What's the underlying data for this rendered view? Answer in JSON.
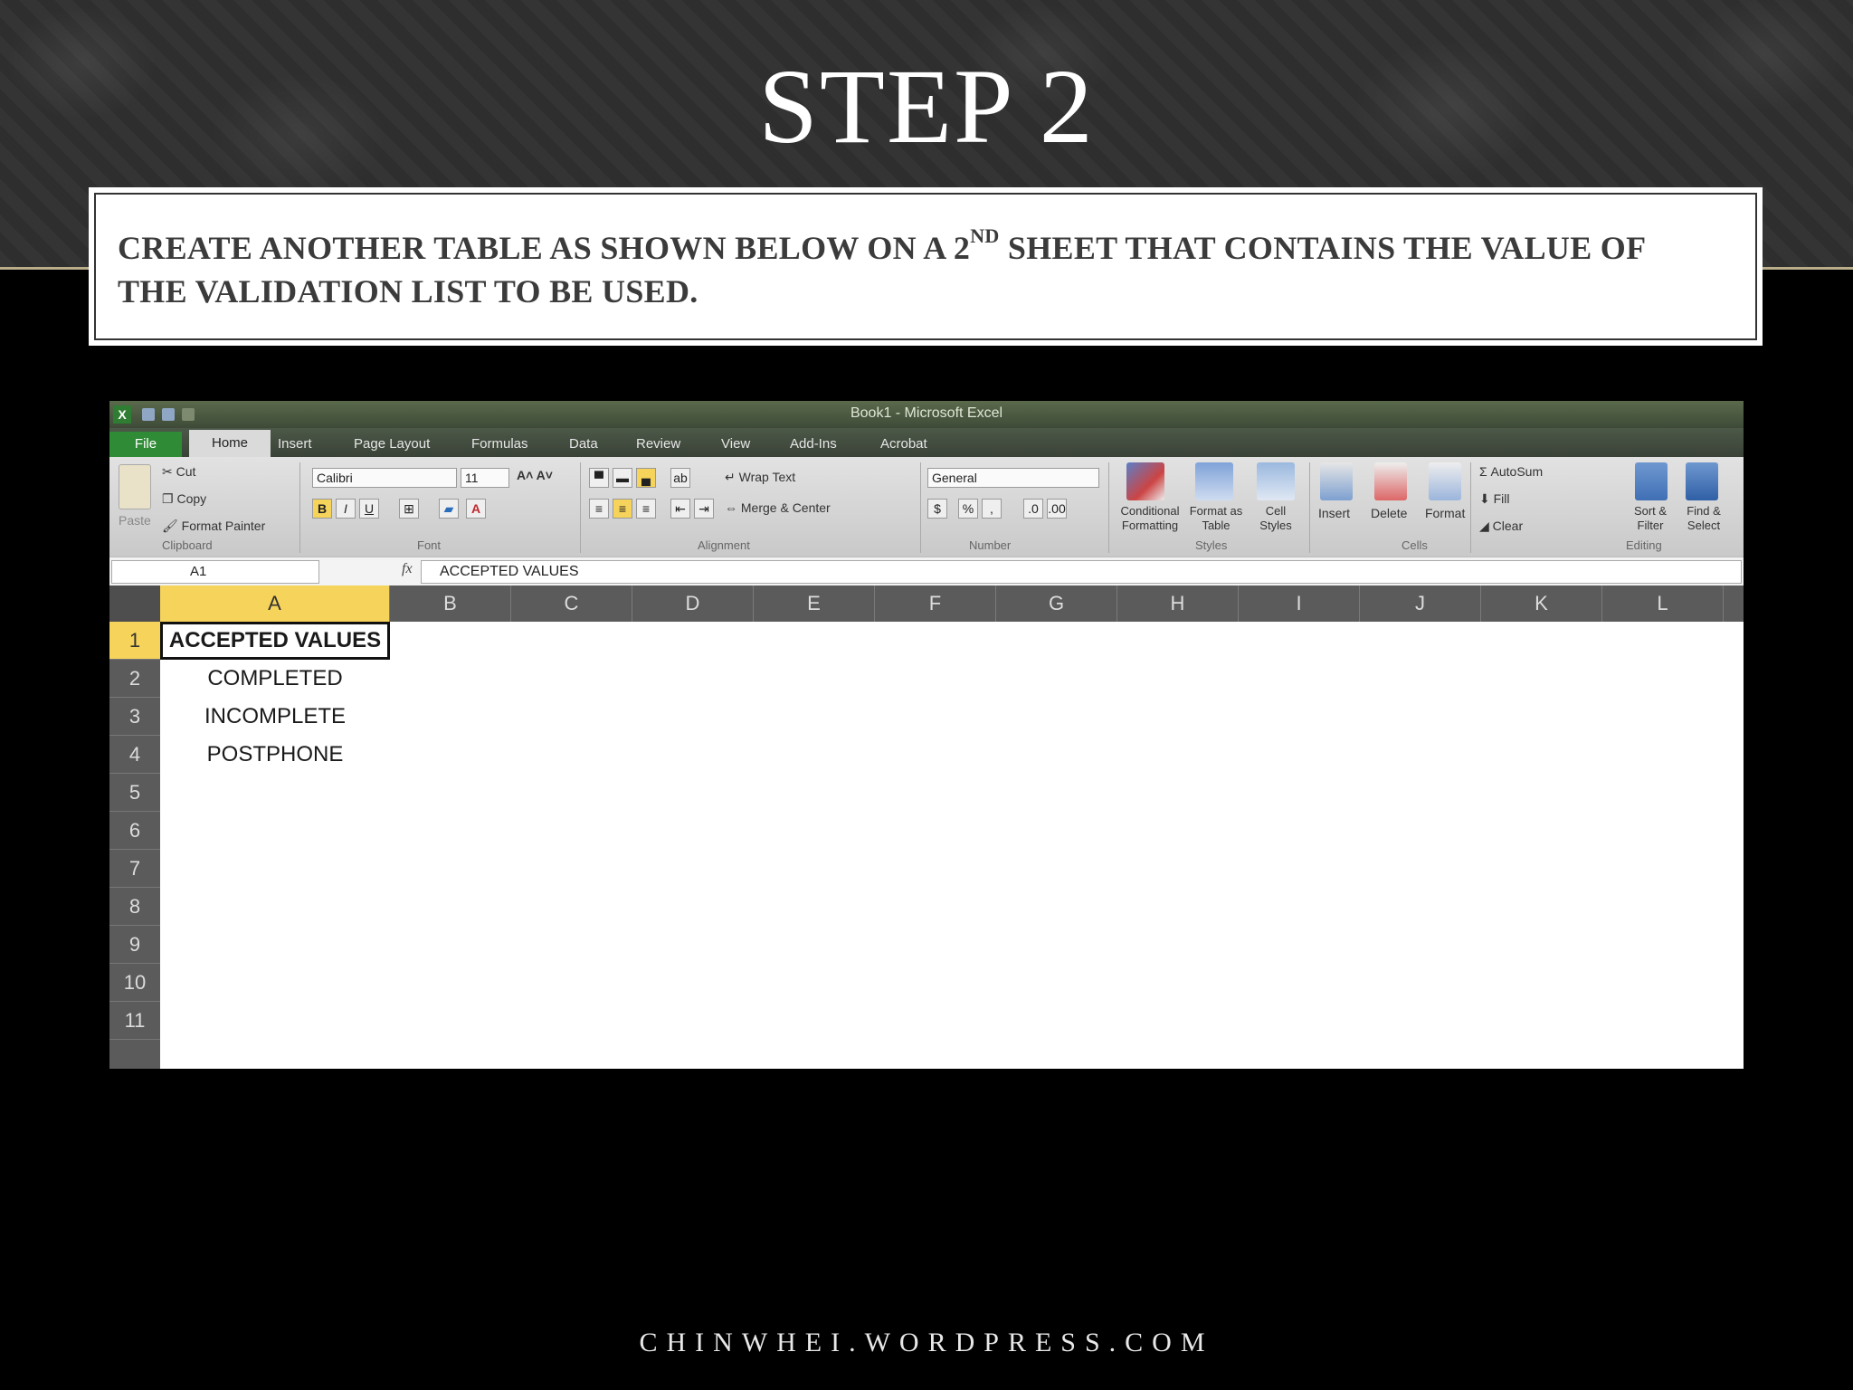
{
  "slide": {
    "title": "STEP 2",
    "instruction_part1": "CREATE ANOTHER TABLE AS SHOWN BELOW ON A 2",
    "instruction_sup": "ND",
    "instruction_part2": " SHEET THAT CONTAINS THE VALUE OF THE VALIDATION LIST TO BE USED.",
    "footer": "CHINWHEI.WORDPRESS.COM"
  },
  "excel": {
    "window_title": "Book1 - Microsoft Excel",
    "tabs": [
      "File",
      "Home",
      "Insert",
      "Page Layout",
      "Formulas",
      "Data",
      "Review",
      "View",
      "Add-Ins",
      "Acrobat"
    ],
    "clipboard": {
      "paste": "Paste",
      "cut": "Cut",
      "copy": "Copy",
      "format_painter": "Format Painter",
      "label": "Clipboard"
    },
    "font": {
      "name": "Calibri",
      "size": "11",
      "bold": "B",
      "italic": "I",
      "underline": "U",
      "label": "Font"
    },
    "alignment": {
      "wrap_text": "Wrap Text",
      "merge_center": "Merge & Center",
      "label": "Alignment"
    },
    "number": {
      "format": "General",
      "currency": "$",
      "percent": "%",
      "comma": ",",
      "label": "Number"
    },
    "styles": {
      "conditional": "Conditional Formatting",
      "format_table": "Format as Table",
      "cell_styles": "Cell Styles",
      "label": "Styles"
    },
    "cells": {
      "insert": "Insert",
      "delete": "Delete",
      "format": "Format",
      "label": "Cells"
    },
    "editing": {
      "autosum": "AutoSum",
      "fill": "Fill",
      "clear": "Clear",
      "sort_filter": "Sort & Filter",
      "find_select": "Find & Select",
      "label": "Editing"
    },
    "name_box": "A1",
    "formula": "ACCEPTED VALUES",
    "columns": [
      "A",
      "B",
      "C",
      "D",
      "E",
      "F",
      "G",
      "H",
      "I",
      "J",
      "K",
      "L"
    ],
    "rows": [
      "1",
      "2",
      "3",
      "4",
      "5",
      "6",
      "7",
      "8",
      "9",
      "10",
      "11"
    ],
    "column_a_values": [
      "ACCEPTED VALUES",
      "COMPLETED",
      "INCOMPLETE",
      "POSTPHONE"
    ],
    "accent_color": "#f6d35a"
  }
}
